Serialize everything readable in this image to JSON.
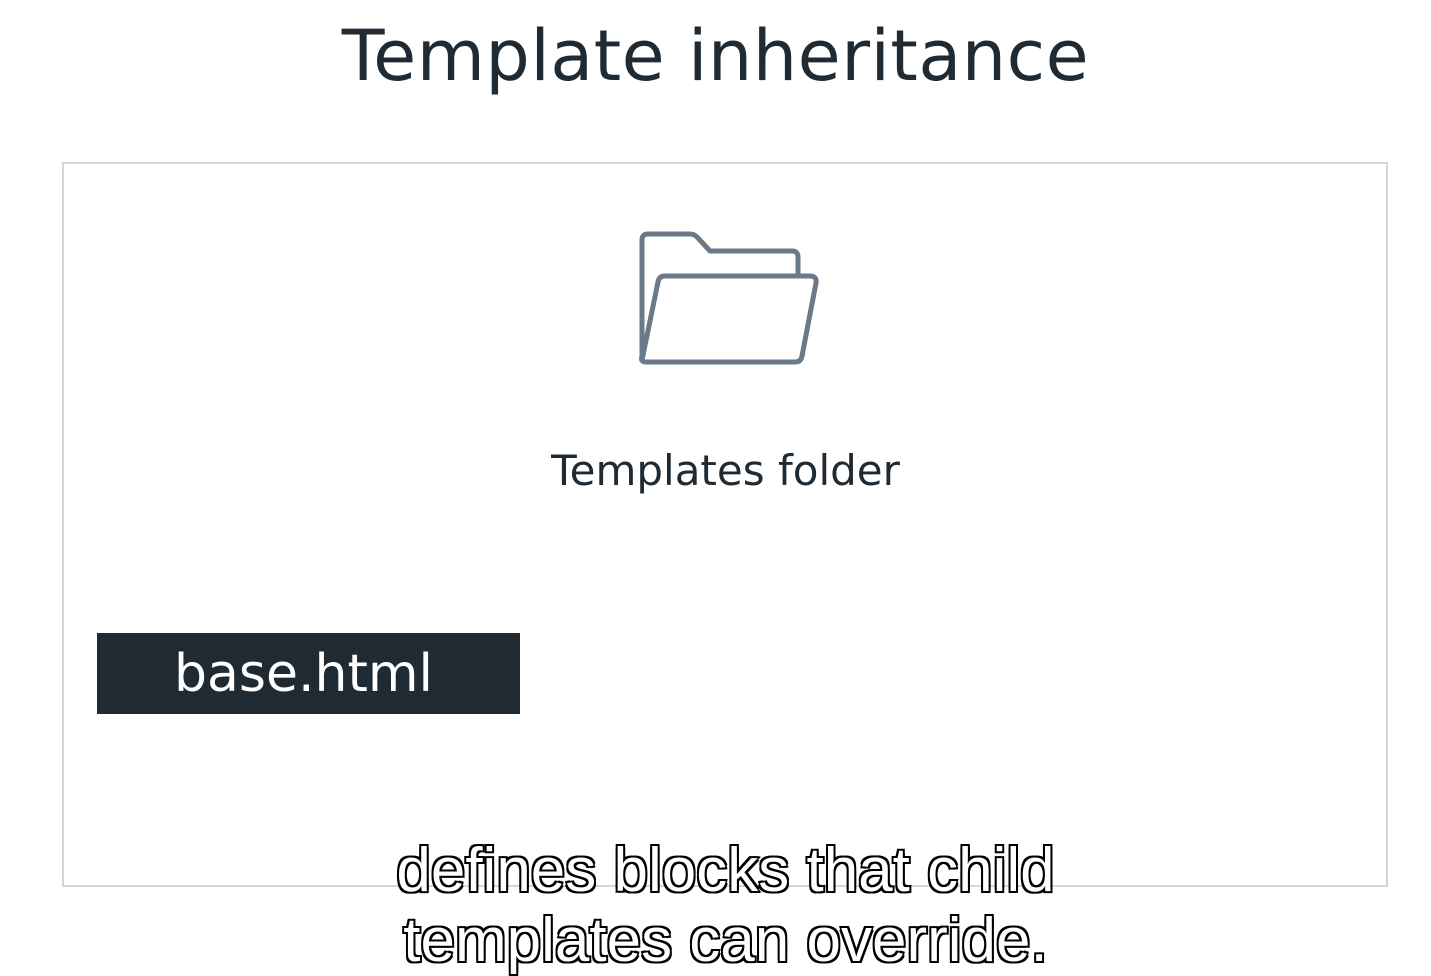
{
  "slide": {
    "title": "Template inheritance",
    "folder_label": "Templates folder",
    "file_badge": "base.html"
  },
  "subtitle": {
    "line1": "defines blocks that child",
    "line2": "templates can override."
  },
  "icons": {
    "folder": "folder-icon"
  },
  "colors": {
    "text_dark": "#1f2a33",
    "frame_border": "#d3d6d9",
    "badge_bg": "#1f2a33",
    "icon_stroke": "#6b7a89"
  }
}
